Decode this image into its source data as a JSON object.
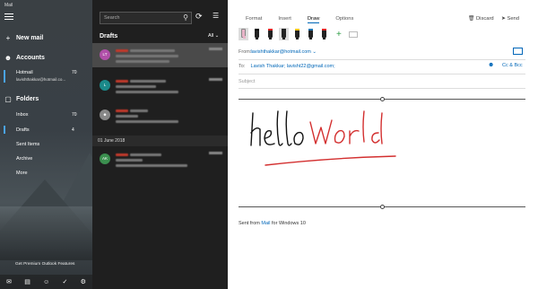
{
  "app": {
    "title": "Mail"
  },
  "nav": {
    "new_mail": "New mail",
    "accounts_label": "Accounts",
    "account": {
      "name": "Hotmail",
      "email": "lavishthakkar@hotmail.co...",
      "count": "70"
    },
    "folders_label": "Folders",
    "folders": [
      {
        "label": "Inbox",
        "count": "70",
        "active": false
      },
      {
        "label": "Drafts",
        "count": "4",
        "active": true
      },
      {
        "label": "Sent Items",
        "count": "",
        "active": false
      },
      {
        "label": "Archive",
        "count": "",
        "active": false
      },
      {
        "label": "More",
        "count": "",
        "active": false
      }
    ],
    "premium": "Get Premium Outlook Features",
    "bottom_icons": [
      "mail-icon",
      "calendar-icon",
      "people-icon",
      "todo-icon",
      "settings-icon"
    ]
  },
  "list": {
    "search_placeholder": "Search",
    "folder_title": "Drafts",
    "filter_label": "All",
    "date_separator": "01 June 2018",
    "messages": [
      {
        "avatar_initials": "LT",
        "avatar_color": "#b04fa8"
      },
      {
        "avatar_initials": "L",
        "avatar_color": "#1b8a8a"
      },
      {
        "avatar_initials": "",
        "avatar_color": "#888888"
      },
      {
        "avatar_initials": "AK",
        "avatar_color": "#3b8f4f"
      }
    ]
  },
  "compose": {
    "tabs": [
      "Format",
      "Insert",
      "Draw",
      "Options"
    ],
    "active_tab": "Draw",
    "discard": "Discard",
    "send": "Send",
    "from_label": "From:",
    "from_value": "lavishthakkar@hotmail.com",
    "to_label": "To:",
    "to_value": "Lavish Thakkar; lavisht22@gmail.com;",
    "cc_bcc": "Cc & Bcc",
    "subject_placeholder": "Subject",
    "ink_text_black": "hello",
    "ink_text_red": "World",
    "signature_prefix": "Sent from ",
    "signature_link": "Mail",
    "signature_suffix": " for Windows 10",
    "pen_colors": [
      "#000000",
      "#e02424",
      "#222222",
      "#f5c518",
      "#1f77b4",
      "#e02424"
    ]
  }
}
